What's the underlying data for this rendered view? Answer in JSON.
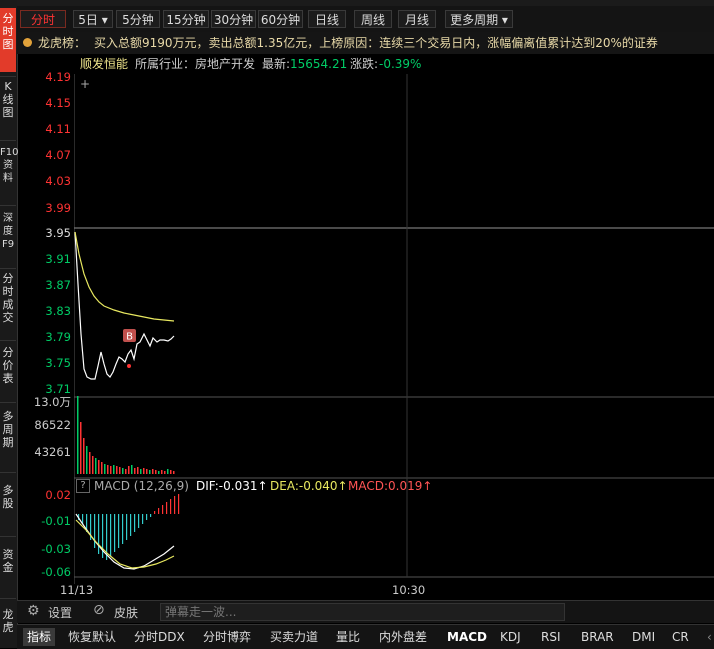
{
  "sidebar": {
    "tabs": [
      {
        "label": "分时图",
        "active": true
      },
      {
        "label": "K线图"
      },
      {
        "label": "F10资料"
      },
      {
        "label": "深度F9"
      },
      {
        "label": "分时成交"
      },
      {
        "label": "分价表"
      },
      {
        "label": "多周期"
      },
      {
        "label": "多股"
      },
      {
        "label": "资金"
      },
      {
        "label": "龙虎"
      }
    ]
  },
  "periods": {
    "items": [
      "分时",
      "5日 ▾",
      "5分钟",
      "15分钟",
      "30分钟",
      "60分钟",
      "日线",
      "周线",
      "月线",
      "更多周期 ▾"
    ],
    "active_index": 0
  },
  "dragon": {
    "label": "龙虎榜：",
    "text": "买入总额9190万元，卖出总额1.35亿元，上榜原因：连续三个交易日内，涨幅偏离值累计达到20%的证券"
  },
  "info": {
    "stock_name": "顺发恒能",
    "industry": "所属行业：房地产开发",
    "latest_label": "最新:",
    "latest_value": "15654.21",
    "change_label": "涨跌:",
    "change_value": "-0.39%"
  },
  "price_axis": {
    "labels": [
      "4.19",
      "4.15",
      "4.11",
      "4.07",
      "4.03",
      "3.99",
      "3.95",
      "3.91",
      "3.87",
      "3.83",
      "3.79",
      "3.75",
      "3.71"
    ],
    "prev_close": "3.95"
  },
  "volume_axis": {
    "labels": [
      "13.0万",
      "86522",
      "43261"
    ]
  },
  "macd_axis": {
    "labels": [
      "0.02",
      "-0.01",
      "-0.03",
      "-0.06"
    ]
  },
  "macd_header": {
    "help": "?",
    "title": "MACD (12,26,9)",
    "dif": "DIF:-0.031↑",
    "dea": "DEA:-0.040↑",
    "macd": "MACD:0.019↑"
  },
  "time_axis": {
    "start": "11/13",
    "mid": "10:30"
  },
  "marker": {
    "label": "B"
  },
  "toolbar": {
    "settings_label": "设置",
    "skin_label": "皮肤",
    "danmaku_placeholder": "弹幕走一波..."
  },
  "indicator_tabs": {
    "items": [
      "指标",
      "恢复默认",
      "分时DDX",
      "分时博弈",
      "买卖力道",
      "量比",
      "内外盘差",
      "MACD",
      "KDJ",
      "RSI",
      "BRAR",
      "DMI",
      "CR"
    ],
    "active_index": 0,
    "highlight_index": 7
  },
  "colors": {
    "up": "#ff3333",
    "down": "#00cc66",
    "price_line": "#ffffff",
    "avg_line": "#e8e860",
    "accent": "#e23b2a"
  }
}
